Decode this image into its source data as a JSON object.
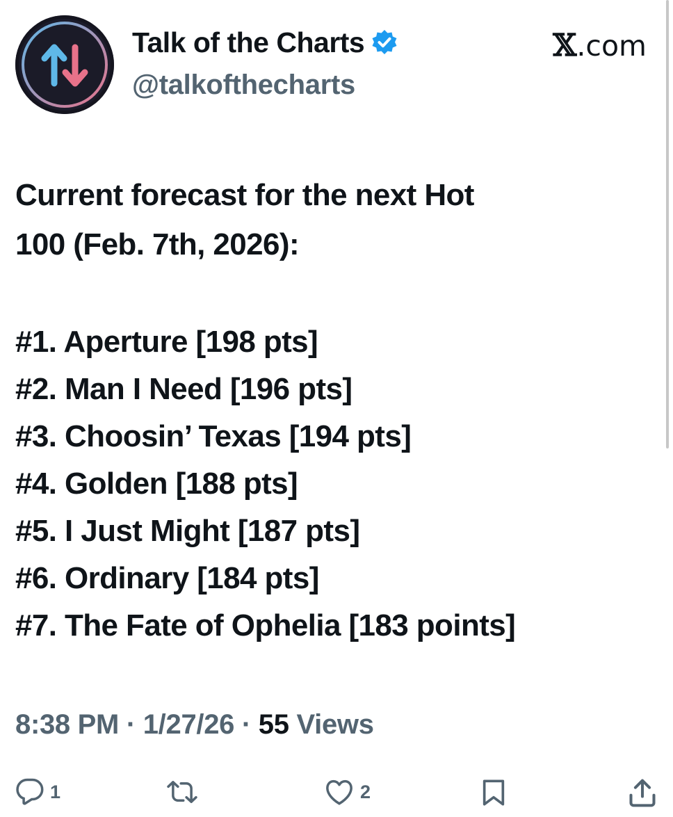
{
  "profile": {
    "display_name": "Talk of the Charts",
    "handle": "@talkofthecharts",
    "verified": true,
    "avatar_icon": "up-down-arrows-icon"
  },
  "brand": {
    "x_glyph": "𝕏",
    "text": ".com"
  },
  "tweet": {
    "line1": "Current forecast for the next Hot",
    "line2": "100 (Feb. 7th, 2026):",
    "rankings": [
      "#1. Aperture [198 pts]",
      "#2. Man I Need [196 pts]",
      "#3. Choosin’ Texas [194 pts]",
      "#4. Golden [188 pts]",
      "#5. I Just Might [187 pts]",
      "#6. Ordinary [184 pts]",
      "#7. The Fate of Ophelia [183 points]"
    ]
  },
  "meta": {
    "time": "8:38 PM",
    "sep1": " · ",
    "date": "1/27/26",
    "sep2": " · ",
    "views_count": "55",
    "views_label": " Views"
  },
  "actions": {
    "reply_count": "1",
    "repost_count": "",
    "like_count": "2"
  },
  "colors": {
    "text": "#0f1419",
    "secondary": "#536471",
    "verified_blue": "#1d9bf0",
    "arrow_up": "#5fb8e8",
    "arrow_down": "#e8728a"
  }
}
